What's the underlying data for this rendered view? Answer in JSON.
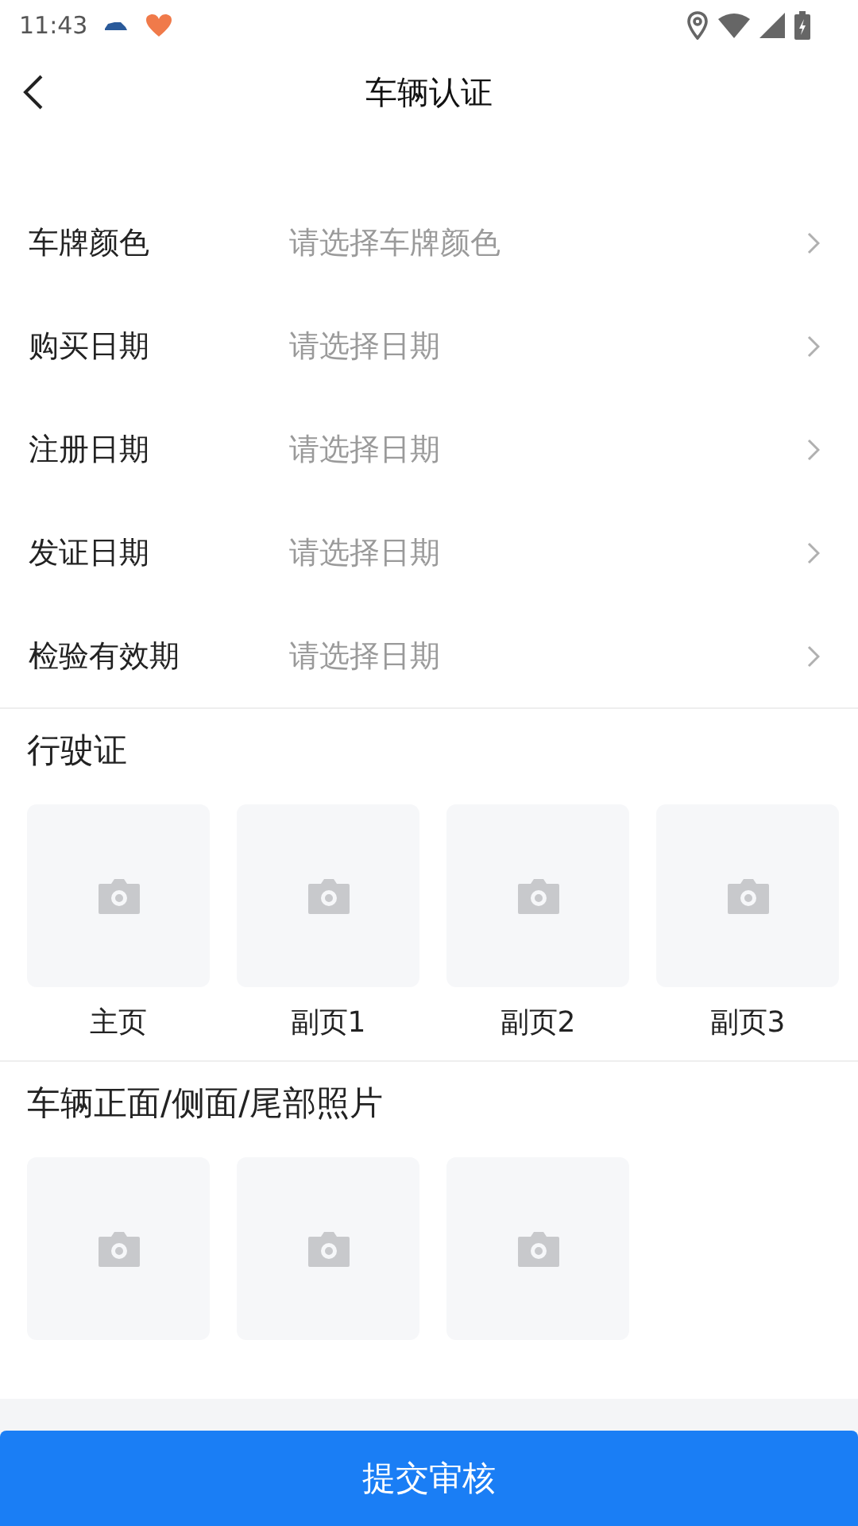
{
  "status_bar": {
    "time": "11:43"
  },
  "header": {
    "title": "车辆认证"
  },
  "fields": [
    {
      "label": "车牌颜色",
      "placeholder": "请选择车牌颜色"
    },
    {
      "label": "购买日期",
      "placeholder": "请选择日期"
    },
    {
      "label": "注册日期",
      "placeholder": "请选择日期"
    },
    {
      "label": "发证日期",
      "placeholder": "请选择日期"
    },
    {
      "label": "检验有效期",
      "placeholder": "请选择日期"
    }
  ],
  "sections": [
    {
      "title": "行驶证",
      "photos": [
        {
          "kind": "upload",
          "caption": "主页"
        },
        {
          "kind": "upload",
          "caption": "副页1"
        },
        {
          "kind": "upload",
          "caption": "副页2"
        },
        {
          "kind": "upload",
          "caption": "副页3"
        }
      ]
    },
    {
      "title": "车辆正面/侧面/尾部照片",
      "photos": [
        {
          "kind": "upload"
        },
        {
          "kind": "upload"
        },
        {
          "kind": "upload"
        }
      ]
    }
  ],
  "submit_button": {
    "label": "提交审核"
  }
}
